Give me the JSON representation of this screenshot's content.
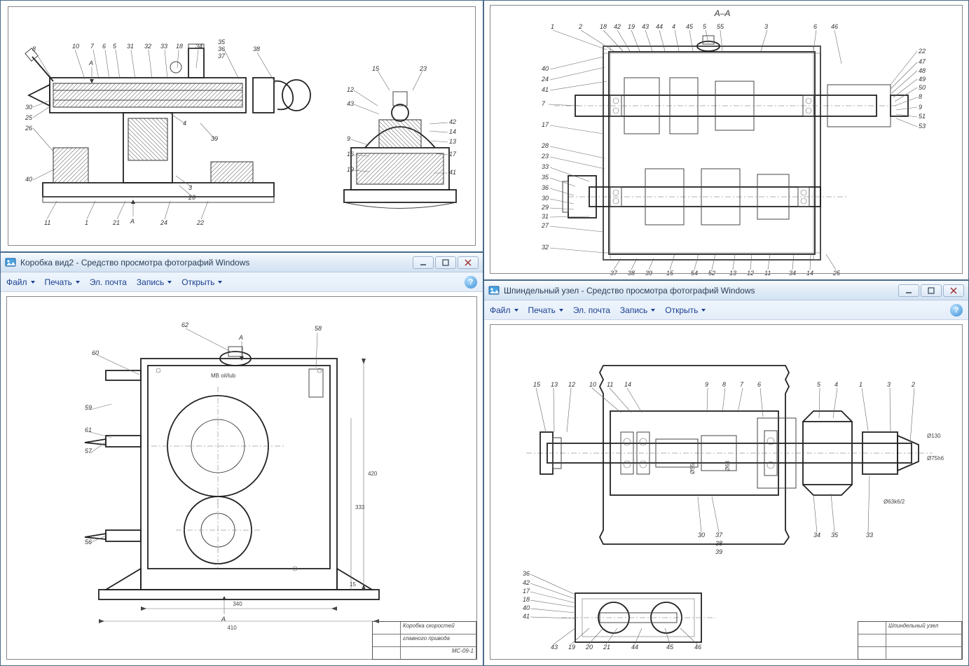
{
  "app_suffix": "Средство просмотра фотографий Windows",
  "menus": {
    "file": "Файл",
    "print": "Печать",
    "email": "Эл. почта",
    "burn": "Запись",
    "open": "Открыть",
    "help_glyph": "?"
  },
  "window_tl": {
    "doc_name": ""
  },
  "window_bl": {
    "doc_name": "Коробка вид2",
    "titleblock_line1": "Коробка скоростей",
    "titleblock_line2": "главного привода",
    "titleblock_code": "МС-09-1"
  },
  "window_tr": {
    "section_label": "A–A"
  },
  "window_br": {
    "doc_name": "Шпиндельный узел",
    "titleblock_line1": "Шпиндельный узел"
  },
  "callouts_tl_left": [
    "8",
    "10",
    "7",
    "6",
    "5",
    "31",
    "32",
    "33",
    "18",
    "34",
    "35",
    "36",
    "37",
    "38",
    "30",
    "25",
    "26",
    "4",
    "39",
    "40",
    "3",
    "20",
    "11",
    "1",
    "21",
    "24",
    "22"
  ],
  "callouts_tl_right": [
    "15",
    "23",
    "12",
    "43",
    "42",
    "14",
    "9",
    "13",
    "16",
    "17",
    "19",
    "41"
  ],
  "callouts_tr_top": [
    "1",
    "2",
    "18",
    "42",
    "19",
    "43",
    "44",
    "4",
    "45",
    "5",
    "55",
    "3",
    "6",
    "46"
  ],
  "callouts_tr_right": [
    "22",
    "47",
    "48",
    "49",
    "50",
    "8",
    "9",
    "51",
    "53"
  ],
  "callouts_tr_left": [
    "40",
    "24",
    "41",
    "7",
    "17",
    "28",
    "23",
    "33",
    "35",
    "36",
    "30",
    "29",
    "31",
    "27",
    "32"
  ],
  "callouts_tr_bottom": [
    "37",
    "38",
    "39",
    "15",
    "54",
    "52",
    "13",
    "12",
    "11",
    "34",
    "14",
    "25"
  ],
  "dims_bl": {
    "width_outer": "410",
    "width_inner": "340",
    "height": "420",
    "depth": "333",
    "marker_top": "МВ oil/lub",
    "small_h": "15"
  },
  "callouts_bl": [
    "62",
    "58",
    "60",
    "59",
    "61",
    "57",
    "56"
  ],
  "section_marker": "A",
  "callouts_br_top": [
    "15",
    "13",
    "12",
    "10",
    "11",
    "14",
    "9",
    "8",
    "7",
    "6",
    "5",
    "4",
    "1",
    "3",
    "2"
  ],
  "callouts_br_right_dims": [
    "Ø130",
    "Ø75h6",
    "Ø55",
    "Ø63",
    "Ø63k6/2"
  ],
  "callouts_br_bottom_upper": [
    "30",
    "37",
    "38",
    "39",
    "34",
    "35",
    "33"
  ],
  "callouts_br_bottom_lower": [
    "36",
    "42",
    "17",
    "18",
    "40",
    "41",
    "43",
    "19",
    "20",
    "21",
    "44",
    "45",
    "46"
  ]
}
